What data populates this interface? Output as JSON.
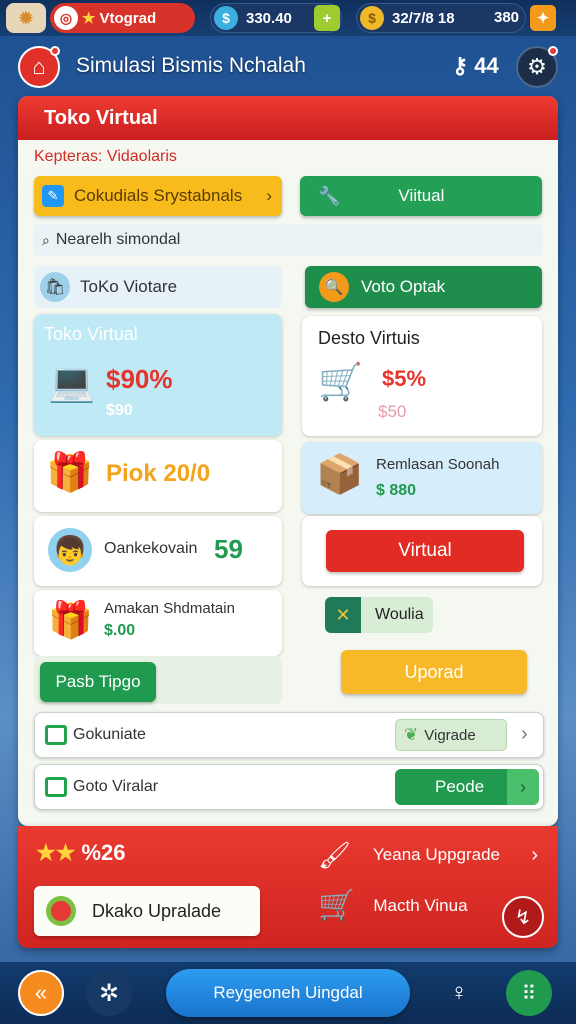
{
  "topbar": {
    "level_label": "Vtograd",
    "coins": "330.40",
    "gold": "32/7/8 18",
    "gems": "380"
  },
  "header": {
    "title": "Simulasi Bismis Nchalah",
    "key_count": "44"
  },
  "panel": {
    "title": "Toko Virtual",
    "section_label": "Kepteras: Vidaolaris",
    "btn_yellow": "Cokudials Srystabnals",
    "btn_green": "Viitual",
    "search_placeholder": "Nearelh simondal",
    "left_tab": "ToKo Viotare",
    "right_tab": "Voto Optak",
    "offer_left": {
      "title": "Toko Virtual",
      "price": "$90%",
      "sub": "$90"
    },
    "offer_right": {
      "title": "Desto Virtuis",
      "price": "$5%",
      "sub": "$50"
    },
    "item_pack": {
      "title": "Piok 20/0"
    },
    "item_bonus": {
      "name": "Remlasan Soonah",
      "price": "$ 880"
    },
    "item_char": {
      "name": "Oankekovain",
      "value": "59"
    },
    "btn_virtual_red": "Virtual",
    "item_gift": {
      "name": "Amakan Shdmatain",
      "price": "$.00"
    },
    "tag_tools": "Woulia",
    "btn_pack_upgrade": "Pasb Tipgo",
    "btn_upgrade_yellow": "Uporad",
    "row1": {
      "label": "Gokuniate",
      "action": "Vigrade"
    },
    "row2": {
      "label": "Goto Viralar",
      "action": "Peode"
    }
  },
  "bottom": {
    "stars_value": "%26",
    "upgrade_link": "Yeana Uppgrade",
    "upgrade_btn": "Dkako Upralade",
    "cart_label": "Macth Vinua"
  },
  "navbar": {
    "main_button": "Reygeoneh Uingdal"
  },
  "colors": {
    "red": "#e5322a",
    "green": "#1f9a4e",
    "yellow": "#f6b81a",
    "blue": "#1e88d8"
  }
}
